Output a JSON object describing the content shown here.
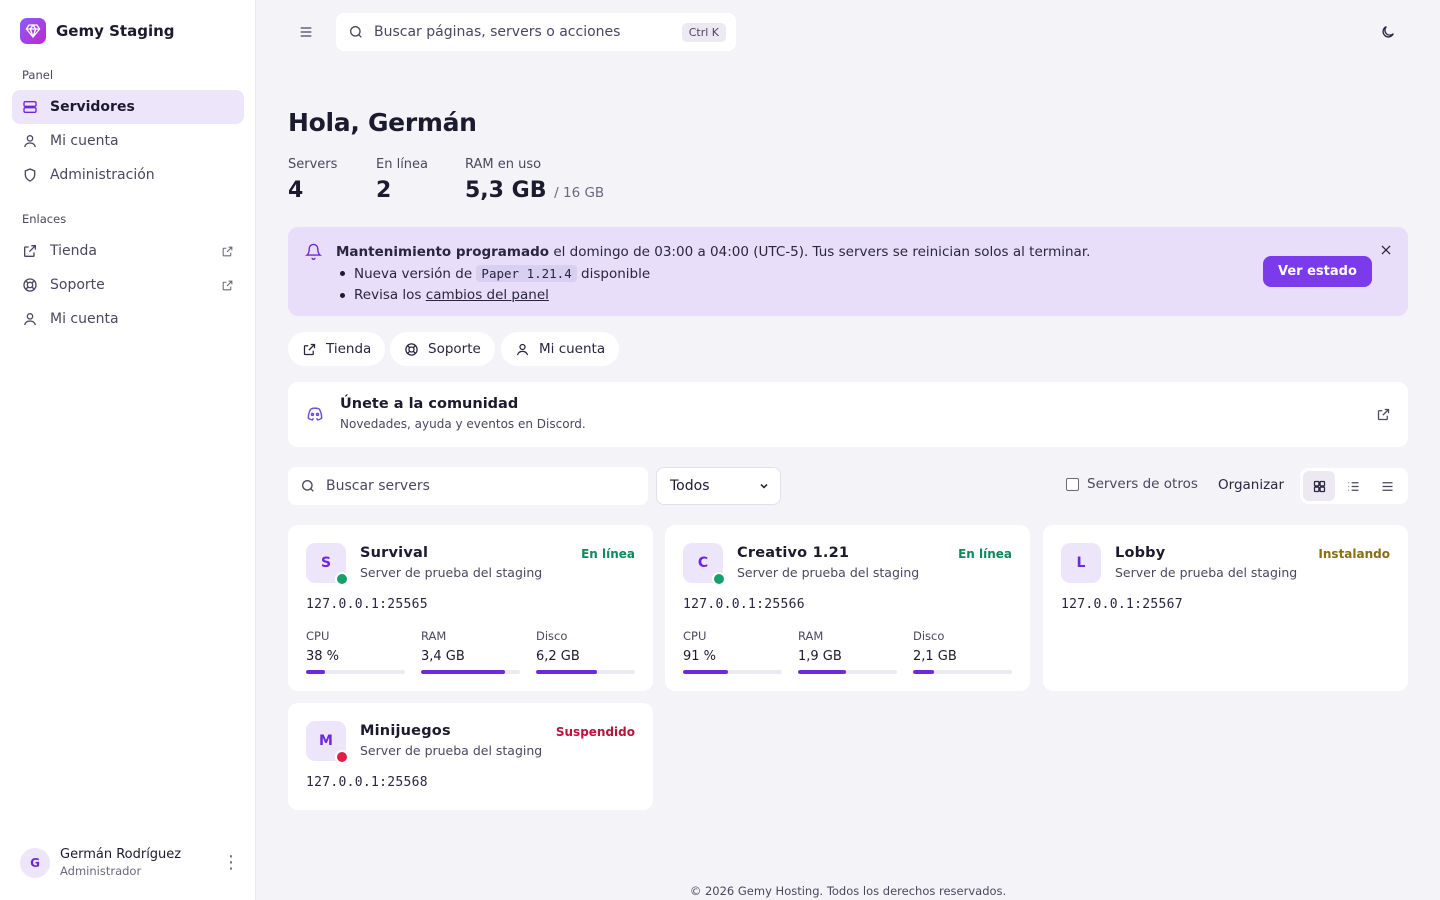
{
  "app": {
    "name": "Gemy Staging"
  },
  "sidebar": {
    "section_panel": "Panel",
    "panel_items": [
      {
        "label": "Servidores",
        "icon": "server-icon",
        "active": true
      },
      {
        "label": "Mi cuenta",
        "icon": "user-icon"
      },
      {
        "label": "Administración",
        "icon": "shield-icon"
      }
    ],
    "section_links": "Enlaces",
    "link_items": [
      {
        "label": "Tienda",
        "icon": "external-link-icon"
      },
      {
        "label": "Soporte",
        "icon": "lifebuoy-icon"
      },
      {
        "label": "Mi cuenta",
        "icon": "user-icon"
      }
    ],
    "user": {
      "initial": "G",
      "name": "Germán Rodríguez",
      "role": "Administrador"
    }
  },
  "topbar": {
    "search_placeholder": "Buscar páginas, servers o acciones",
    "shortcut": "Ctrl K"
  },
  "greeting": "Hola, Germán",
  "stats": [
    {
      "label": "Servers",
      "value": "4"
    },
    {
      "label": "En línea",
      "value": "2"
    },
    {
      "label": "RAM en uso",
      "value": "5,3 GB",
      "sub": "/ 16 GB"
    }
  ],
  "banner": {
    "title": "Mantenimiento programado",
    "text": " el domingo de 03:00 a 04:00 (UTC-5). Tus servers se reinician solos al terminar.",
    "item1_pre": "Nueva versión de ",
    "item1_code": "Paper 1.21.4",
    "item1_post": " disponible",
    "item2_pre": "Revisa los ",
    "item2_link": "cambios del panel",
    "button": "Ver estado"
  },
  "quick_links": [
    {
      "label": "Tienda"
    },
    {
      "label": "Soporte"
    },
    {
      "label": "Mi cuenta"
    }
  ],
  "community": {
    "title": "Únete a la comunidad",
    "subtitle": "Novedades, ayuda y eventos en Discord."
  },
  "filters": {
    "search_placeholder": "Buscar servers",
    "select_value": "Todos",
    "others_label": "Servers de otros",
    "organize_label": "Organizar"
  },
  "colors": {
    "accent": "#7c3aed",
    "online": "#16a06b",
    "installing": "#8a6d12",
    "suspended": "#be123c"
  },
  "servers": [
    {
      "initial": "S",
      "name": "Survival",
      "desc": "Server de prueba del staging",
      "status": "En línea",
      "status_color": "#0f8a5a",
      "dot": "#16a06b",
      "address": "127.0.0.1:25565",
      "metrics": [
        {
          "label": "CPU",
          "value": "38 %",
          "fraction": 0.19
        },
        {
          "label": "RAM",
          "value": "3,4 GB",
          "fraction": 0.85
        },
        {
          "label": "Disco",
          "value": "6,2 GB",
          "fraction": 0.62
        }
      ]
    },
    {
      "initial": "C",
      "name": "Creativo 1.21",
      "desc": "Server de prueba del staging",
      "status": "En línea",
      "status_color": "#0f8a5a",
      "dot": "#16a06b",
      "address": "127.0.0.1:25566",
      "metrics": [
        {
          "label": "CPU",
          "value": "91 %",
          "fraction": 0.45
        },
        {
          "label": "RAM",
          "value": "1,9 GB",
          "fraction": 0.48
        },
        {
          "label": "Disco",
          "value": "2,1 GB",
          "fraction": 0.21
        }
      ]
    },
    {
      "initial": "L",
      "name": "Lobby",
      "desc": "Server de prueba del staging",
      "status": "Instalando",
      "status_color": "#8a6d12",
      "address": "127.0.0.1:25567",
      "metrics": []
    },
    {
      "initial": "M",
      "name": "Minijuegos",
      "desc": "Server de prueba del staging",
      "status": "Suspendido",
      "status_color": "#be123c",
      "dot": "#e11d48",
      "address": "127.0.0.1:25568",
      "metrics": []
    }
  ],
  "footer": "© 2026 Gemy Hosting. Todos los derechos reservados."
}
